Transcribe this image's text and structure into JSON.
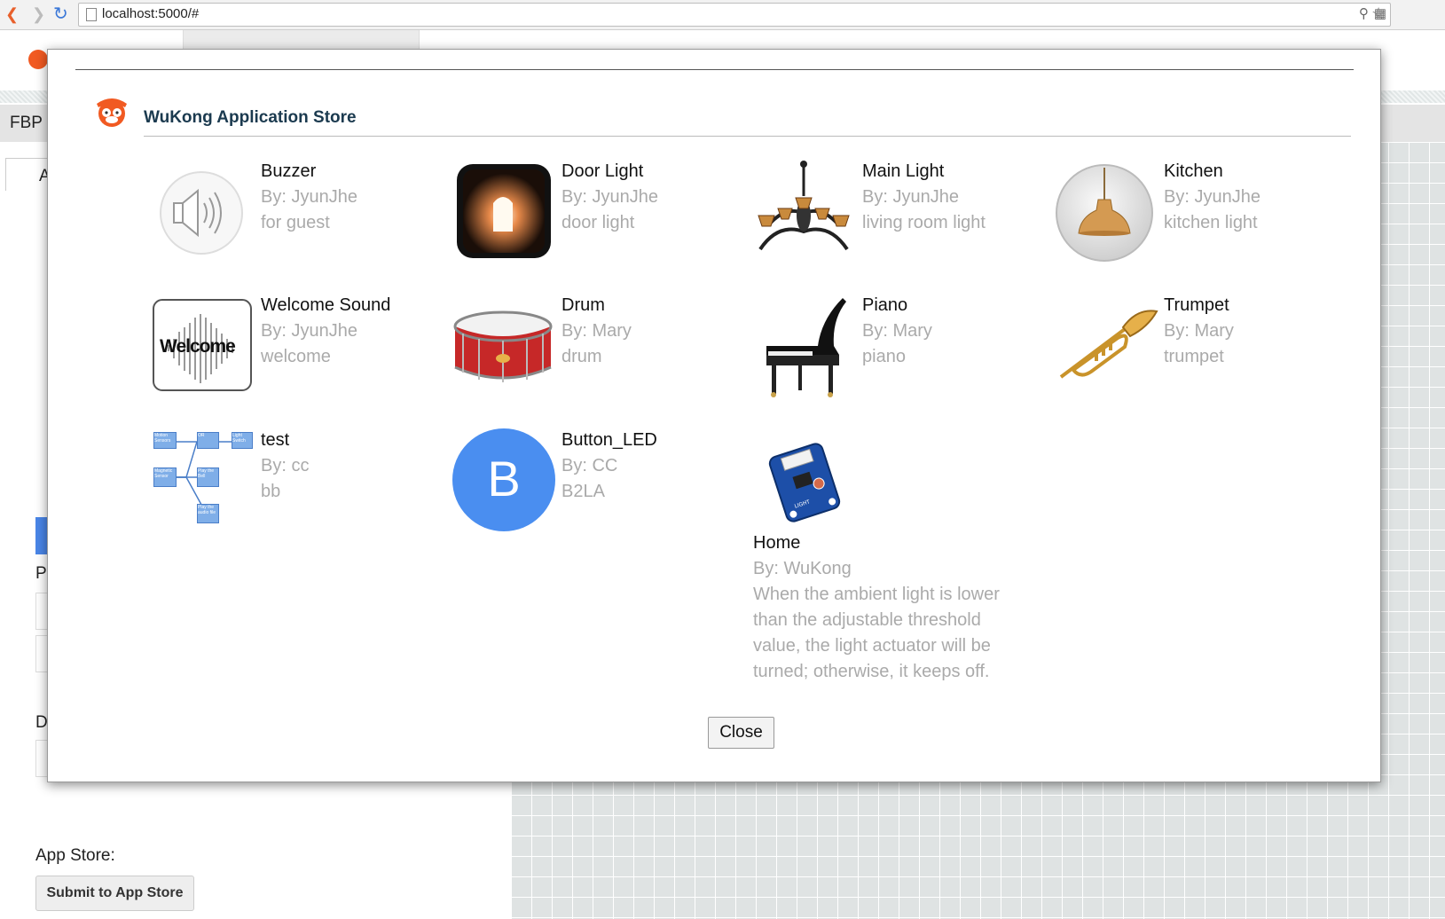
{
  "browser": {
    "url": "localhost:5000/#"
  },
  "background": {
    "nav_label": "FBP",
    "tab_letter": "A",
    "section_letter_p": "P",
    "section_letter_d": "D",
    "appstore_label": "App Store:",
    "submit_button": "Submit to App Store"
  },
  "modal": {
    "title": "WuKong Application Store",
    "close_button": "Close",
    "apps": [
      {
        "name": "Buzzer",
        "author": "By: JyunJhe",
        "description": "for guest",
        "icon": "speaker-icon"
      },
      {
        "name": "Door Light",
        "author": "By: JyunJhe",
        "description": "door light",
        "icon": "doorway-light-icon"
      },
      {
        "name": "Main Light",
        "author": "By: JyunJhe",
        "description": "living room light",
        "icon": "chandelier-icon"
      },
      {
        "name": "Kitchen",
        "author": "By: JyunJhe",
        "description": "kitchen light",
        "icon": "pendant-lamp-icon"
      },
      {
        "name": "Welcome Sound",
        "author": "By: JyunJhe",
        "description": "welcome",
        "icon": "welcome-waveform-icon"
      },
      {
        "name": "Drum",
        "author": "By: Mary",
        "description": "drum",
        "icon": "drum-icon"
      },
      {
        "name": "Piano",
        "author": "By: Mary",
        "description": "piano",
        "icon": "piano-icon"
      },
      {
        "name": "Trumpet",
        "author": "By: Mary",
        "description": "trumpet",
        "icon": "trumpet-icon"
      },
      {
        "name": "test",
        "author": "By: cc",
        "description": "bb",
        "icon": "flow-diagram-icon"
      },
      {
        "name": "Button_LED",
        "author": "By: CC",
        "description": "B2LA",
        "icon": "letter-avatar-icon",
        "avatar_letter": "B",
        "avatar_color": "#4a8ef0"
      },
      {
        "name": "Home",
        "author": "By: WuKong",
        "description": "When the ambient light is lower than the adjustable threshold value, the light actuator will be turned; otherwise, it keeps off.",
        "icon": "light-sensor-board-icon"
      }
    ],
    "diagram_labels": [
      "Motion Sensors",
      "OR",
      "Light Switch",
      "Magnetic Sensor",
      "Play the Bell",
      "Play the audio file"
    ]
  },
  "colors": {
    "accent": "#f15a22",
    "title": "#1b3a4f",
    "muted_text": "#aaaaaa",
    "avatar_blue": "#4a8ef0"
  }
}
